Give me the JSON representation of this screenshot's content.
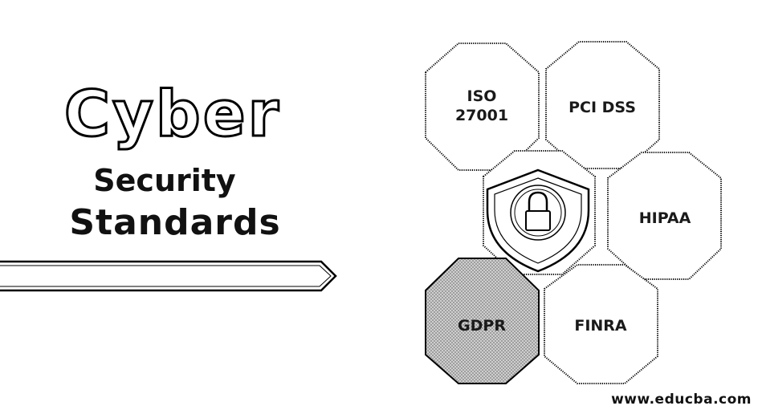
{
  "hero": {
    "title": "Cyber",
    "subtitle_line1": "Security",
    "subtitle_line2": "Standards"
  },
  "standards": [
    {
      "line1": "ISO",
      "line2": "27001"
    },
    {
      "line1": "PCI DSS",
      "line2": ""
    },
    {
      "line1": "HIPAA",
      "line2": ""
    },
    {
      "line1": "GDPR",
      "line2": ""
    },
    {
      "line1": "FINRA",
      "line2": ""
    }
  ],
  "graphic": {
    "center_icon": "padlock-icon",
    "shield_icon": "shield-icon",
    "highlighted_standard": "GDPR"
  },
  "footer": {
    "url": "www.educba.com"
  },
  "colors": {
    "stroke": "#000000",
    "text": "#111111",
    "highlight_fill": "#bdbdbd",
    "background": "#ffffff"
  }
}
